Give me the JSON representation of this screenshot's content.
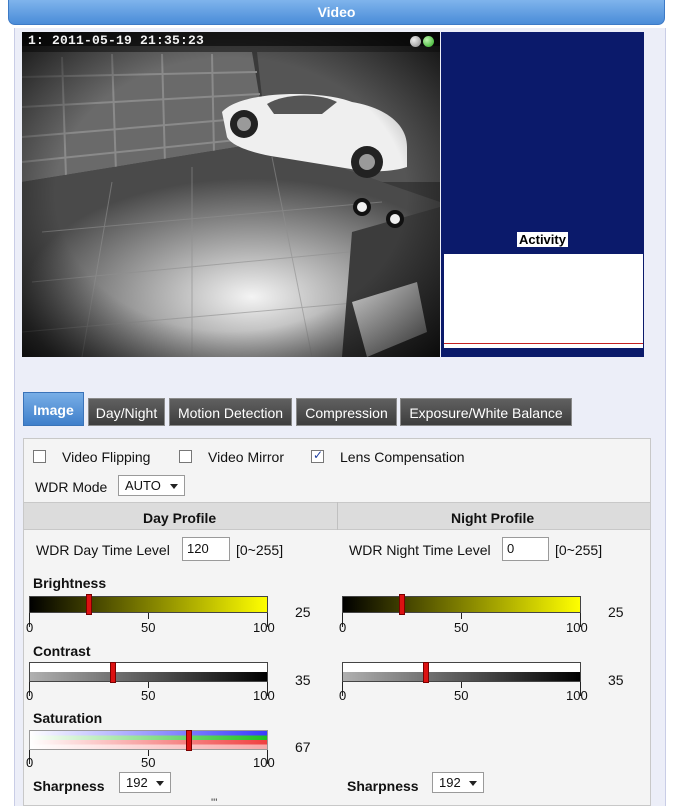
{
  "header": {
    "title": "Video"
  },
  "video": {
    "osd": "1:   2011-05-19 21:35:23"
  },
  "activity": {
    "title": "Activity"
  },
  "tabs": [
    {
      "label": "Image",
      "active": true
    },
    {
      "label": "Day/Night"
    },
    {
      "label": "Motion Detection"
    },
    {
      "label": "Compression"
    },
    {
      "label": "Exposure/White Balance"
    }
  ],
  "options": {
    "video_flipping": {
      "label": "Video Flipping",
      "checked": false
    },
    "video_mirror": {
      "label": "Video Mirror",
      "checked": false
    },
    "lens_compensation": {
      "label": "Lens Compensation",
      "checked": true
    }
  },
  "wdr": {
    "label": "WDR Mode",
    "value": "AUTO"
  },
  "day": {
    "title": "Day Profile",
    "wdr_level_label": "WDR Day Time Level",
    "wdr_level_value": "120",
    "range": "[0~255]",
    "brightness": 25,
    "contrast": 35,
    "saturation": 67,
    "sharpness": "192"
  },
  "night": {
    "title": "Night Profile",
    "wdr_level_label": "WDR Night Time Level",
    "wdr_level_value": "0",
    "range": "[0~255]",
    "brightness": 25,
    "contrast": 35,
    "sharpness": "192"
  },
  "labels": {
    "brightness": "Brightness",
    "contrast": "Contrast",
    "saturation": "Saturation",
    "sharpness": "Sharpness"
  },
  "scale": {
    "min": "0",
    "mid": "50",
    "max": "100"
  },
  "footer": {
    "mark": "'''"
  }
}
